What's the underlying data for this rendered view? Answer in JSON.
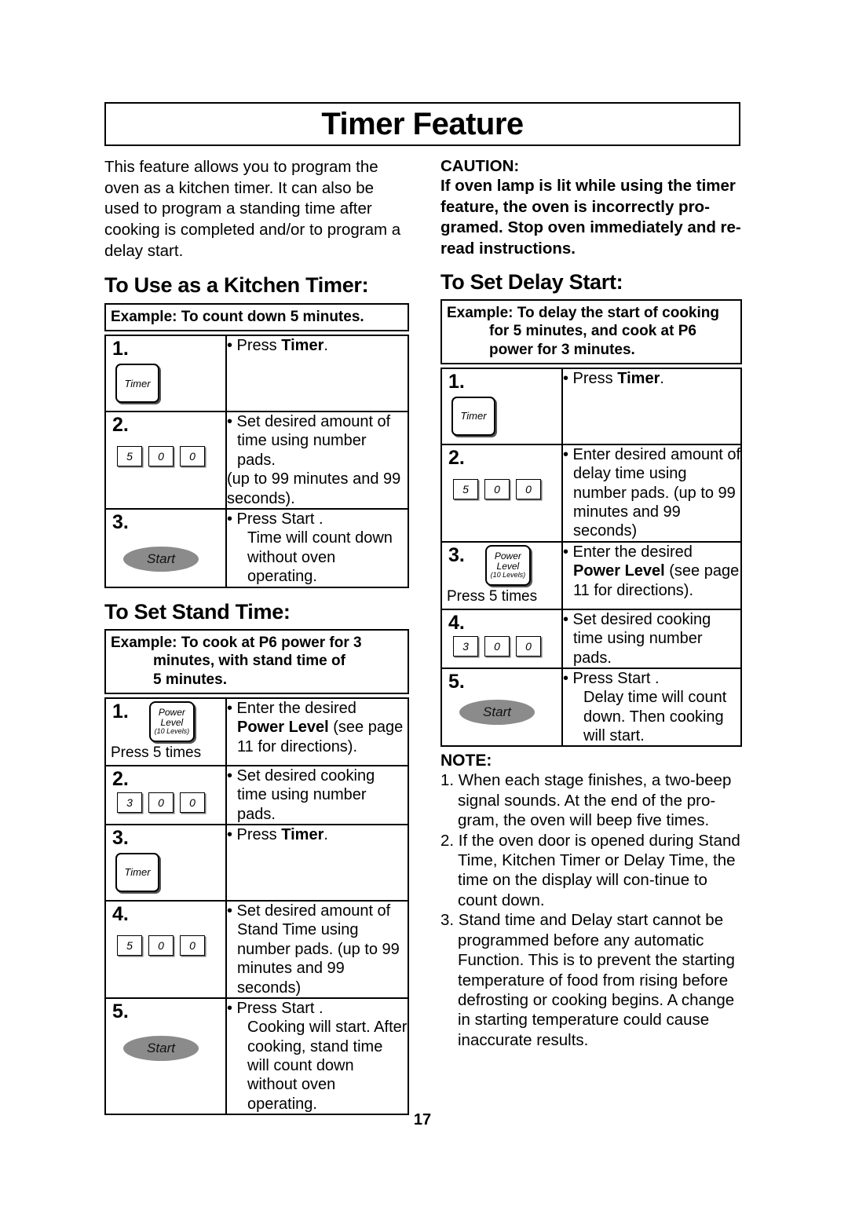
{
  "document": {
    "title": "Timer Feature",
    "page_number": "17"
  },
  "intro": {
    "paragraph": "This feature allows you to program the oven as a kitchen timer. It can also be used to program a standing time after cooking is completed and/or to program a delay start."
  },
  "caution": {
    "heading": "CAUTION:",
    "body": "If oven lamp is lit while using the timer feature, the oven is incorrectly pro-gramed. Stop oven immediately and re-read instructions."
  },
  "sections": {
    "kitchen_timer": {
      "heading": "To Use  as a Kitchen Timer:",
      "example": {
        "line1": "Example: To count down 5 minutes."
      },
      "steps": [
        {
          "num": "1.",
          "control": "timer-button",
          "control_label": "Timer",
          "text_lines": [
            {
              "style": "bullet",
              "parts": [
                {
                  "t": "Press ",
                  "b": false
                },
                {
                  "t": "Timer",
                  "b": true
                },
                {
                  "t": ".",
                  "b": false
                }
              ]
            }
          ]
        },
        {
          "num": "2.",
          "control": "number-pads",
          "pads": [
            "5",
            "0",
            "0"
          ],
          "text_lines": [
            {
              "style": "bullet",
              "parts": [
                {
                  "t": "Set desired amount of time using number pads.",
                  "b": false
                }
              ]
            },
            {
              "style": "plain",
              "parts": [
                {
                  "t": "(up to 99 minutes and 99 seconds).",
                  "b": false
                }
              ]
            }
          ]
        },
        {
          "num": "3.",
          "control": "start-button",
          "control_label": "Start",
          "text_lines": [
            {
              "style": "bullet",
              "parts": [
                {
                  "t": "Press Start .",
                  "b": false
                }
              ]
            },
            {
              "style": "sub",
              "parts": [
                {
                  "t": "Time will count down without oven operating.",
                  "b": false
                }
              ]
            }
          ]
        }
      ]
    },
    "stand_time": {
      "heading": "To Set Stand Time:",
      "example": {
        "line1": "Example: To cook at P6 power for 3",
        "line2": "minutes, with stand time of",
        "line3": "5 minutes."
      },
      "steps": [
        {
          "num": "1.",
          "control": "power-level-button",
          "power_label_1": "Power",
          "power_label_2": "Level",
          "power_label_3": "(10 Levels)",
          "press_times": "Press 5 times",
          "text_lines": [
            {
              "style": "bullet",
              "parts": [
                {
                  "t": "Enter the desired ",
                  "b": false
                },
                {
                  "t": "Power Level",
                  "b": true
                },
                {
                  "t": " (see page 11 for directions).",
                  "b": false
                }
              ]
            }
          ]
        },
        {
          "num": "2.",
          "control": "number-pads",
          "pads": [
            "3",
            "0",
            "0"
          ],
          "text_lines": [
            {
              "style": "bullet",
              "parts": [
                {
                  "t": "Set desired cooking time using number pads.",
                  "b": false
                }
              ]
            }
          ]
        },
        {
          "num": "3.",
          "control": "timer-button",
          "control_label": "Timer",
          "text_lines": [
            {
              "style": "bullet",
              "parts": [
                {
                  "t": "Press ",
                  "b": false
                },
                {
                  "t": "Timer",
                  "b": true
                },
                {
                  "t": ".",
                  "b": false
                }
              ]
            }
          ]
        },
        {
          "num": "4.",
          "control": "number-pads",
          "pads": [
            "5",
            "0",
            "0"
          ],
          "text_lines": [
            {
              "style": "bullet",
              "parts": [
                {
                  "t": "Set desired amount of Stand Time using number pads. (up to 99 minutes and 99 seconds)",
                  "b": false
                }
              ]
            }
          ]
        },
        {
          "num": "5.",
          "control": "start-button",
          "control_label": "Start",
          "text_lines": [
            {
              "style": "bullet",
              "parts": [
                {
                  "t": "Press Start .",
                  "b": false
                }
              ]
            },
            {
              "style": "sub",
              "parts": [
                {
                  "t": "Cooking will start. After cooking, stand time will count down without oven operating.",
                  "b": false
                }
              ]
            }
          ]
        }
      ]
    },
    "delay_start": {
      "heading": "To Set Delay Start:",
      "example": {
        "line1": "Example: To delay the start of cooking",
        "line2": "for 5 minutes, and cook at P6",
        "line3": "power for 3 minutes."
      },
      "steps": [
        {
          "num": "1.",
          "control": "timer-button",
          "control_label": "Timer",
          "text_lines": [
            {
              "style": "bullet",
              "parts": [
                {
                  "t": "Press ",
                  "b": false
                },
                {
                  "t": "Timer",
                  "b": true
                },
                {
                  "t": ".",
                  "b": false
                }
              ]
            }
          ]
        },
        {
          "num": "2.",
          "control": "number-pads",
          "pads": [
            "5",
            "0",
            "0"
          ],
          "text_lines": [
            {
              "style": "bullet",
              "parts": [
                {
                  "t": "Enter desired amount of delay time using number pads. (up to 99 minutes and 99 seconds)",
                  "b": false
                }
              ]
            }
          ]
        },
        {
          "num": "3.",
          "control": "power-level-button",
          "power_label_1": "Power",
          "power_label_2": "Level",
          "power_label_3": "(10 Levels)",
          "press_times": "Press 5 times",
          "text_lines": [
            {
              "style": "bullet",
              "parts": [
                {
                  "t": "Enter the desired ",
                  "b": false
                },
                {
                  "t": "Power Level",
                  "b": true
                },
                {
                  "t": " (see page 11 for directions).",
                  "b": false
                }
              ]
            }
          ]
        },
        {
          "num": "4.",
          "control": "number-pads",
          "pads": [
            "3",
            "0",
            "0"
          ],
          "text_lines": [
            {
              "style": "bullet",
              "parts": [
                {
                  "t": "Set desired cooking time using number pads.",
                  "b": false
                }
              ]
            }
          ]
        },
        {
          "num": "5.",
          "control": "start-button",
          "control_label": "Start",
          "text_lines": [
            {
              "style": "bullet",
              "parts": [
                {
                  "t": "Press Start .",
                  "b": false
                }
              ]
            },
            {
              "style": "sub",
              "parts": [
                {
                  "t": "Delay time will count down. Then cooking will start.",
                  "b": false
                }
              ]
            }
          ]
        }
      ]
    }
  },
  "note": {
    "heading": "NOTE:",
    "items": [
      "1. When each stage finishes, a two-beep signal sounds. At the end of the pro-gram, the oven will beep five times.",
      "2. If the oven door is opened during Stand Time, Kitchen Timer or Delay Time, the time on the display will con-tinue to count down.",
      "3. Stand time and Delay start cannot be programmed before any automatic Function. This is to prevent the starting temperature of food from rising before defrosting or cooking begins. A change in starting temperature could cause inaccurate results."
    ]
  }
}
